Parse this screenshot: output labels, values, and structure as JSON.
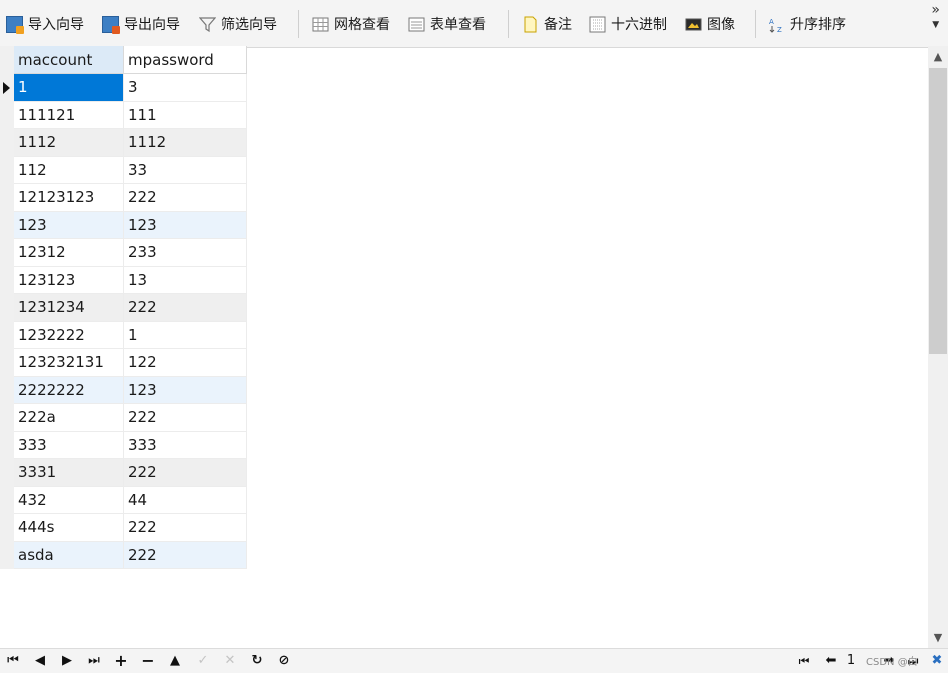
{
  "toolbar": {
    "import_label": "导入向导",
    "export_label": "导出向导",
    "filter_label": "筛选向导",
    "grid_view_label": "网格查看",
    "form_view_label": "表单查看",
    "memo_label": "备注",
    "hex_label": "十六进制",
    "image_label": "图像",
    "sort_label": "升序排序",
    "overflow_label": "»"
  },
  "table": {
    "columns": [
      "maccount",
      "mpassword"
    ],
    "rows": [
      [
        "1",
        "3"
      ],
      [
        "111121",
        "111"
      ],
      [
        "1112",
        "1112"
      ],
      [
        "112",
        "33"
      ],
      [
        "12123123",
        "222"
      ],
      [
        "123",
        "123"
      ],
      [
        "12312",
        "233"
      ],
      [
        "123123",
        "13"
      ],
      [
        "1231234",
        "222"
      ],
      [
        "1232222",
        "1"
      ],
      [
        "123232131",
        "122"
      ],
      [
        "2222222",
        "123"
      ],
      [
        "222a",
        "222"
      ],
      [
        "333",
        "333"
      ],
      [
        "3331",
        "222"
      ],
      [
        "432",
        "44"
      ],
      [
        "444s",
        "222"
      ],
      [
        "asda",
        "222"
      ]
    ]
  },
  "nav": {
    "page_number": "1",
    "watermark": "CSDN @白"
  },
  "colors": {
    "selected_cell": "#0078d7",
    "alt_row_gray": "#efefef",
    "alt_row_blue": "#eaf3fc",
    "header_active": "#dceaf7"
  }
}
